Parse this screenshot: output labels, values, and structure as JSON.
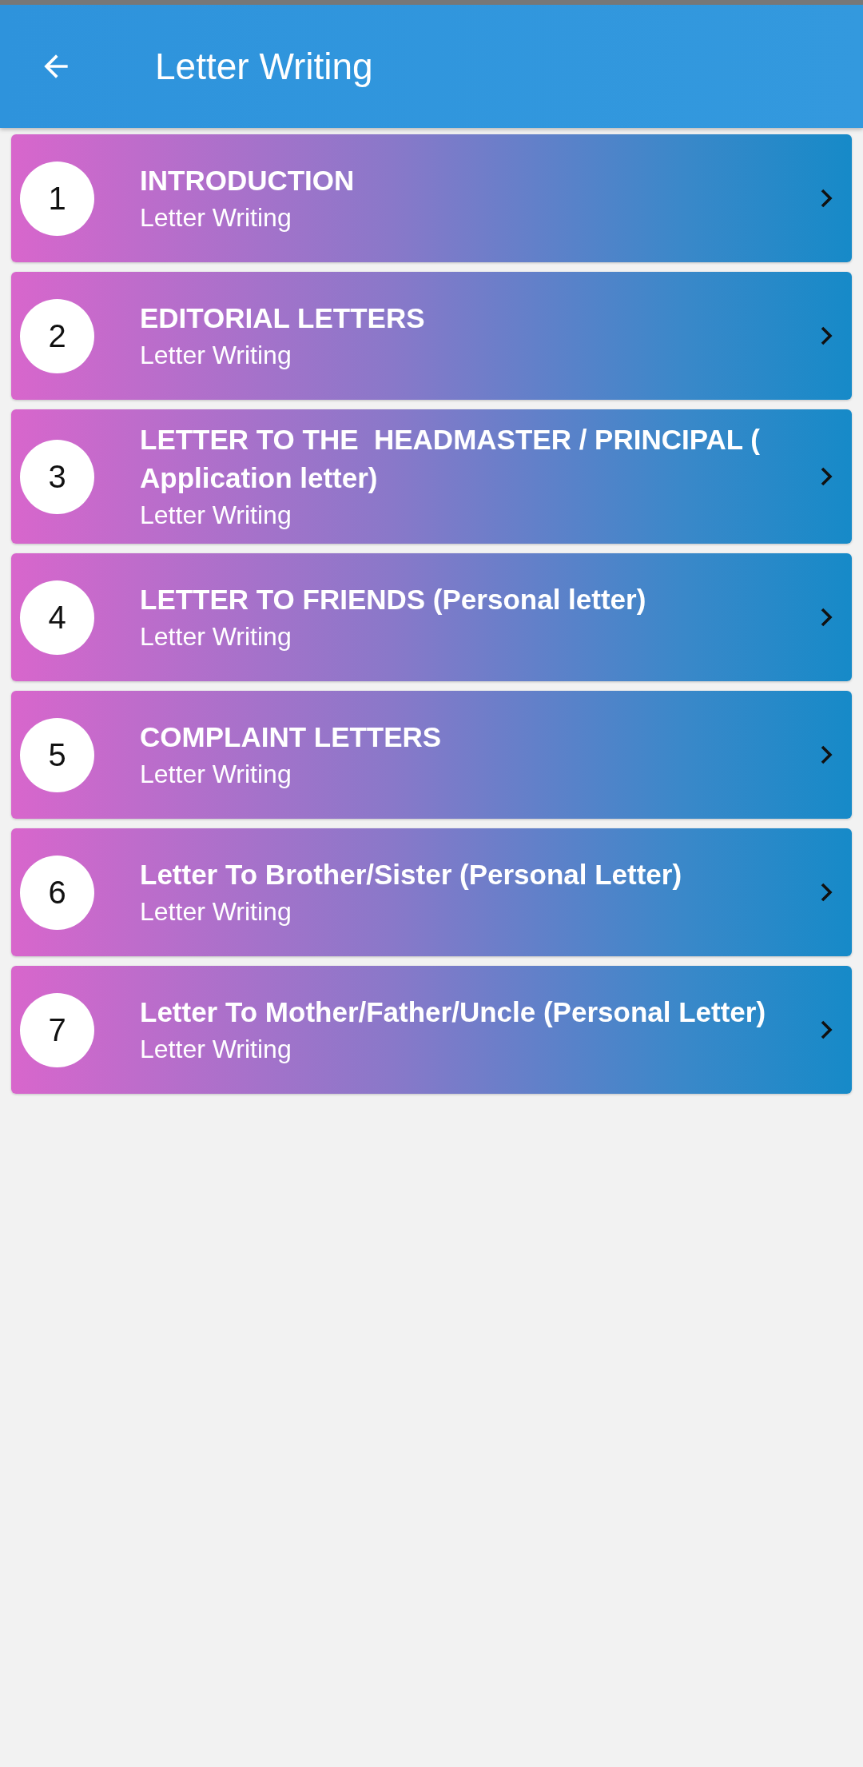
{
  "app_bar": {
    "title": "Letter Writing"
  },
  "items": [
    {
      "number": "1",
      "title": "INTRODUCTION",
      "subtitle": "Letter Writing"
    },
    {
      "number": "2",
      "title": "EDITORIAL LETTERS",
      "subtitle": "Letter Writing"
    },
    {
      "number": "3",
      "title": "LETTER TO THE  HEADMASTER / PRINCIPAL ( Application letter)",
      "subtitle": "Letter Writing"
    },
    {
      "number": "4",
      "title": "LETTER TO FRIENDS (Personal letter)",
      "subtitle": "Letter Writing"
    },
    {
      "number": "5",
      "title": "COMPLAINT LETTERS",
      "subtitle": "Letter Writing"
    },
    {
      "number": "6",
      "title": "Letter To Brother/Sister (Personal Letter)",
      "subtitle": "Letter Writing"
    },
    {
      "number": "7",
      "title": "Letter To Mother/Father/Uncle (Personal Letter)",
      "subtitle": "Letter Writing"
    }
  ]
}
